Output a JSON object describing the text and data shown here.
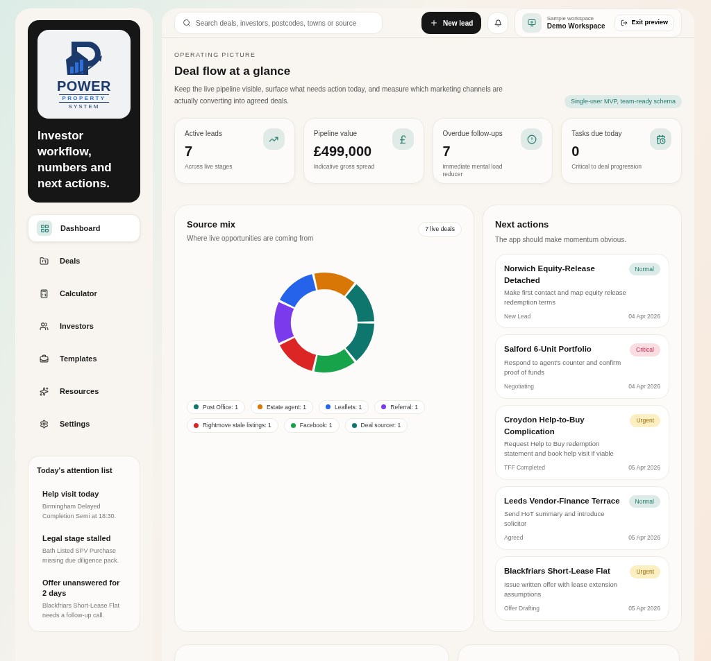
{
  "sidebar": {
    "logo": {
      "title": "POWER",
      "subtitle": "PROPERTY",
      "tagline": "SYSTEM"
    },
    "headline": "Investor workflow, numbers and next actions.",
    "nav": [
      {
        "label": "Dashboard",
        "selected": true
      },
      {
        "label": "Deals",
        "selected": false
      },
      {
        "label": "Calculator",
        "selected": false
      },
      {
        "label": "Investors",
        "selected": false
      },
      {
        "label": "Templates",
        "selected": false
      },
      {
        "label": "Resources",
        "selected": false
      },
      {
        "label": "Settings",
        "selected": false
      }
    ],
    "attention": {
      "title": "Today's attention list",
      "items": [
        {
          "title": "Help visit today",
          "detail": "Birmingham Delayed Completion Semi at 18:30."
        },
        {
          "title": "Legal stage stalled",
          "detail": "Bath Listed SPV Purchase missing due diligence pack."
        },
        {
          "title": "Offer unanswered for 2 days",
          "detail": "Blackfriars Short-Lease Flat needs a follow-up call."
        }
      ]
    }
  },
  "topbar": {
    "search": {
      "placeholder": "Search deals, investors, postcodes, towns or source"
    },
    "new_lead": "New lead",
    "workspace": {
      "caption": "Sample workspace",
      "name": "Demo Workspace"
    },
    "exit": "Exit preview"
  },
  "header": {
    "eyebrow": "OPERATING PICTURE",
    "title": "Deal flow at a glance",
    "description": "Keep the live pipeline visible, surface what needs action today, and measure which marketing channels are actually converting into agreed deals.",
    "badge": "Single-user MVP, team-ready schema"
  },
  "stats": [
    {
      "label": "Active leads",
      "value": "7",
      "note": "Across live stages"
    },
    {
      "label": "Pipeline value",
      "value": "£499,000",
      "note": "Indicative gross spread"
    },
    {
      "label": "Overdue follow-ups",
      "value": "7",
      "note": "Immediate mental load reducer"
    },
    {
      "label": "Tasks due today",
      "value": "0",
      "note": "Critical to deal progression"
    }
  ],
  "source_mix": {
    "title": "Source mix",
    "subtitle": "Where live opportunities are coming from",
    "badge": "7 live deals",
    "chart_data": {
      "type": "donut",
      "categories": [
        "Post Office: 1",
        "Estate agent: 1",
        "Leaflets: 1",
        "Referral: 1",
        "Rightmove stale listings: 1",
        "Facebook: 1",
        "Deal sourcer: 1"
      ],
      "values": [
        1,
        1,
        1,
        1,
        1,
        1,
        1
      ]
    },
    "legend": [
      {
        "color": "#0f766e"
      },
      {
        "color": "#d97706"
      },
      {
        "color": "#2563eb"
      },
      {
        "color": "#7c3aed"
      },
      {
        "color": "#dc2626"
      },
      {
        "color": "#16a34a"
      },
      {
        "color": "#0f766e"
      }
    ]
  },
  "next_actions": {
    "title": "Next actions",
    "subtitle": "The app should make momentum obvious.",
    "items": [
      {
        "title": "Norwich Equity-Release Detached",
        "priority": "Normal",
        "kind": "normal",
        "task": "Make first contact and map equity release redemption terms",
        "stage": "New Lead",
        "date": "04 Apr 2026"
      },
      {
        "title": "Salford 6-Unit Portfolio",
        "priority": "Critical",
        "kind": "critical",
        "task": "Respond to agent's counter and confirm proof of funds",
        "stage": "Negotiating",
        "date": "04 Apr 2026"
      },
      {
        "title": "Croydon Help-to-Buy Complication",
        "priority": "Urgent",
        "kind": "urgent",
        "task": "Request Help to Buy redemption statement and book help visit if viable",
        "stage": "TFF Completed",
        "date": "05 Apr 2026"
      },
      {
        "title": "Leeds Vendor-Finance Terrace",
        "priority": "Normal",
        "kind": "normal",
        "task": "Send HoT summary and introduce solicitor",
        "stage": "Agreed",
        "date": "05 Apr 2026"
      },
      {
        "title": "Blackfriars Short-Lease Flat",
        "priority": "Urgent",
        "kind": "urgent",
        "task": "Issue written offer with lease extension assumptions",
        "stage": "Offer Drafting",
        "date": "05 Apr 2026"
      }
    ]
  }
}
